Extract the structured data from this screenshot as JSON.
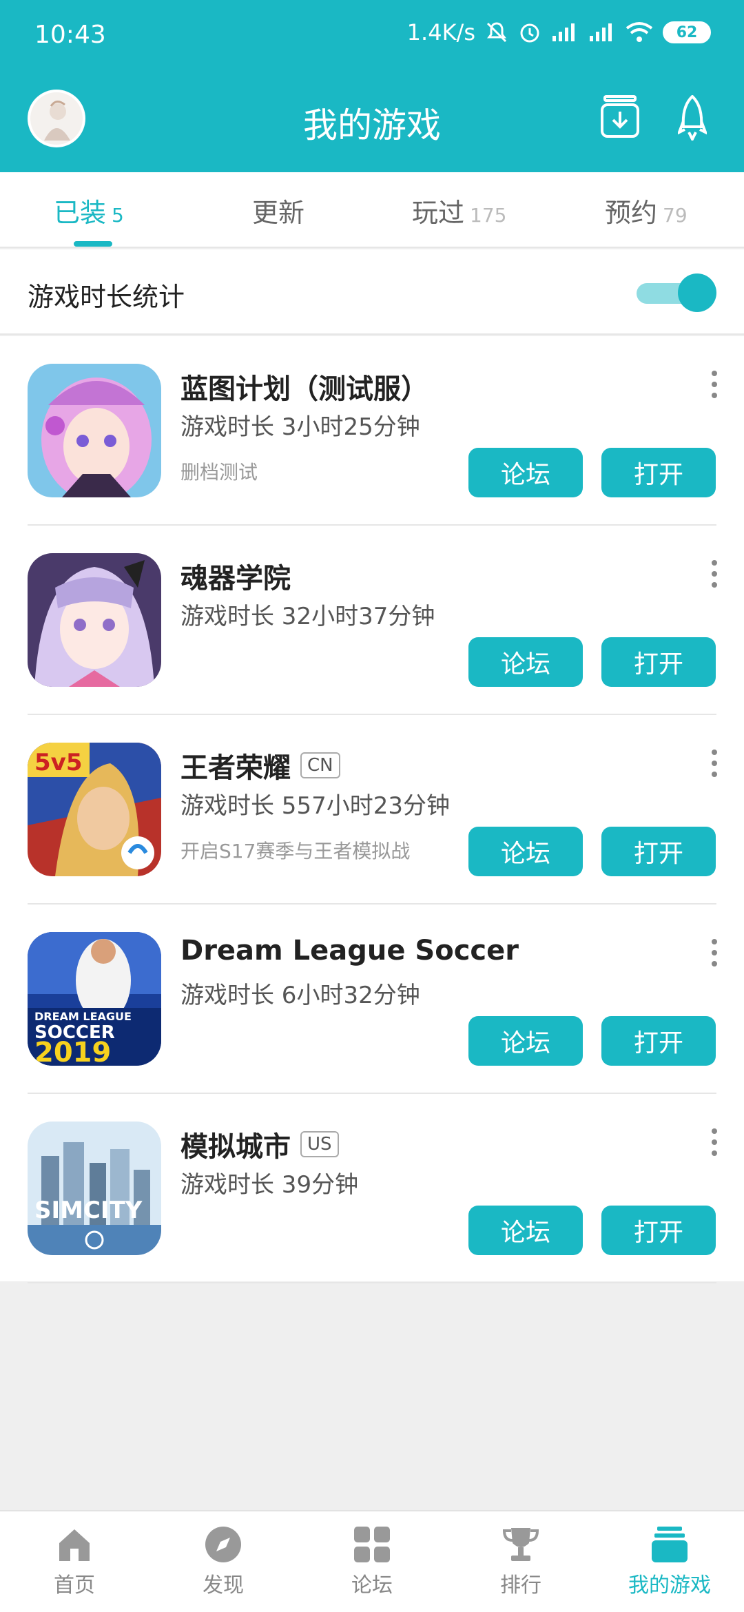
{
  "status_bar": {
    "time": "10:43",
    "speed": "1.4K/s",
    "battery": "62"
  },
  "header": {
    "title": "我的游戏"
  },
  "tabs": [
    {
      "label": "已装",
      "count": "5"
    },
    {
      "label": "更新",
      "count": ""
    },
    {
      "label": "玩过",
      "count": "175"
    },
    {
      "label": "预约",
      "count": "79"
    }
  ],
  "stat": {
    "label": "游戏时长统计",
    "enabled": true
  },
  "games": [
    {
      "name": "蓝图计划（测试服）",
      "tag": "",
      "time": "游戏时长 3小时25分钟",
      "note": "删档测试"
    },
    {
      "name": "魂器学院",
      "tag": "",
      "time": "游戏时长 32小时37分钟",
      "note": ""
    },
    {
      "name": "王者荣耀",
      "tag": "CN",
      "time": "游戏时长 557小时23分钟",
      "note": "开启S17赛季与王者模拟战"
    },
    {
      "name": "Dream League Soccer",
      "tag": "",
      "time": "游戏时长 6小时32分钟",
      "note": ""
    },
    {
      "name": "模拟城市",
      "tag": "US",
      "time": "游戏时长 39分钟",
      "note": ""
    }
  ],
  "buttons": {
    "forum": "论坛",
    "open": "打开"
  },
  "bottom_nav": [
    {
      "label": "首页",
      "icon": "home-icon"
    },
    {
      "label": "发现",
      "icon": "compass-icon"
    },
    {
      "label": "论坛",
      "icon": "grid-icon"
    },
    {
      "label": "排行",
      "icon": "trophy-icon"
    },
    {
      "label": "我的游戏",
      "icon": "stack-icon"
    }
  ],
  "colors": {
    "accent": "#1ab8c4",
    "background": "#efefef"
  }
}
